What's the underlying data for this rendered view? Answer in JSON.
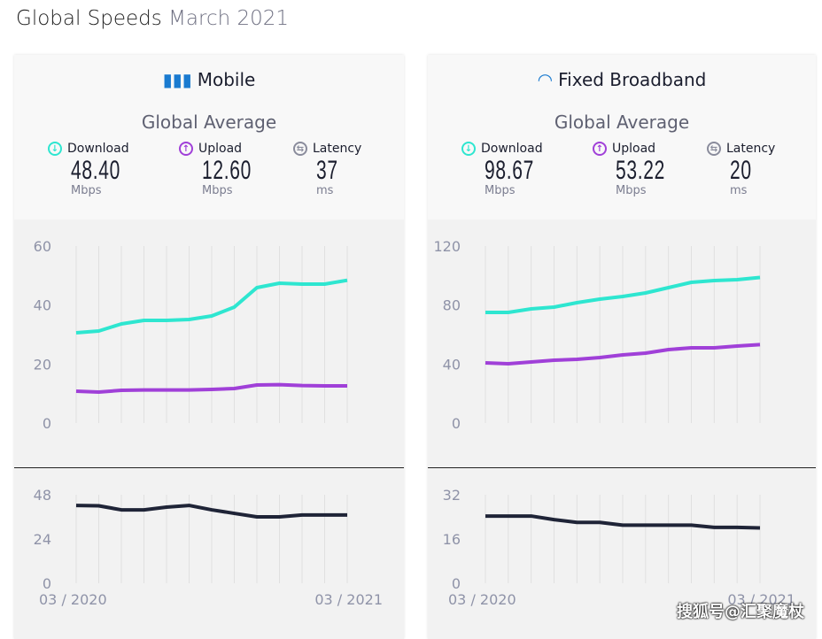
{
  "header": {
    "title": "Global Speeds",
    "subtitle": "March 2021"
  },
  "colors": {
    "download": "#2ee6d0",
    "upload": "#a040d8",
    "latency": "#1f2437",
    "icon": "#1a7bd0"
  },
  "cards": [
    {
      "title": "Mobile",
      "icon": "signal-bars-icon",
      "avg_label": "Global Average",
      "metrics": [
        {
          "label": "Download",
          "value": "48.40",
          "unit": "Mbps"
        },
        {
          "label": "Upload",
          "value": "12.60",
          "unit": "Mbps"
        },
        {
          "label": "Latency",
          "value": "37",
          "unit": "ms"
        }
      ]
    },
    {
      "title": "Fixed Broadband",
      "icon": "wifi-icon",
      "avg_label": "Global Average",
      "metrics": [
        {
          "label": "Download",
          "value": "98.67",
          "unit": "Mbps"
        },
        {
          "label": "Upload",
          "value": "53.22",
          "unit": "Mbps"
        },
        {
          "label": "Latency",
          "value": "20",
          "unit": "ms"
        }
      ]
    }
  ],
  "chart_data": [
    {
      "type": "line",
      "panel": "Mobile speed",
      "ylim": [
        0,
        60
      ],
      "yticks": [
        "0",
        "20",
        "40",
        "60"
      ],
      "grid": "vertical",
      "series": [
        {
          "name": "Download",
          "values": [
            30.6,
            31.2,
            33.6,
            34.8,
            34.8,
            35.1,
            36.3,
            39.3,
            45.9,
            47.4,
            47.1,
            47.1,
            48.4
          ]
        },
        {
          "name": "Upload",
          "values": [
            10.8,
            10.5,
            11.1,
            11.2,
            11.2,
            11.2,
            11.4,
            11.7,
            12.9,
            13.0,
            12.7,
            12.6,
            12.6
          ]
        }
      ]
    },
    {
      "type": "line",
      "panel": "Mobile latency",
      "ylim": [
        0,
        48
      ],
      "yticks": [
        "0",
        "24",
        "48"
      ],
      "xticks": [
        "03 / 2020",
        "03 / 2021"
      ],
      "grid": "vertical",
      "series": [
        {
          "name": "Latency",
          "values": [
            42.2,
            42,
            39.8,
            39.8,
            41.3,
            42.2,
            39.8,
            37.9,
            36,
            36,
            37,
            37,
            37
          ]
        }
      ]
    },
    {
      "type": "line",
      "panel": "Fixed Broadband speed",
      "ylim": [
        0,
        120
      ],
      "yticks": [
        "0",
        "40",
        "80",
        "120"
      ],
      "grid": "vertical",
      "series": [
        {
          "name": "Download",
          "values": [
            75,
            75,
            77.4,
            78.6,
            81.6,
            84,
            85.8,
            88.2,
            91.8,
            95.4,
            96.6,
            97.2,
            98.7
          ]
        },
        {
          "name": "Upload",
          "values": [
            40.8,
            40.2,
            41.4,
            42.6,
            43.2,
            44.4,
            46.2,
            47.4,
            49.8,
            51,
            51,
            52.2,
            53.2
          ]
        }
      ]
    },
    {
      "type": "line",
      "panel": "Fixed Broadband latency",
      "ylim": [
        0,
        32
      ],
      "yticks": [
        "0",
        "16",
        "32"
      ],
      "xticks": [
        "03 / 2020",
        "03 / 2021"
      ],
      "grid": "vertical",
      "series": [
        {
          "name": "Latency",
          "values": [
            24.3,
            24.3,
            24.3,
            23,
            22,
            22,
            21,
            21,
            21,
            21,
            20.2,
            20.2,
            20
          ]
        }
      ]
    }
  ],
  "watermark": "搜狐号@汇聚魔杖"
}
